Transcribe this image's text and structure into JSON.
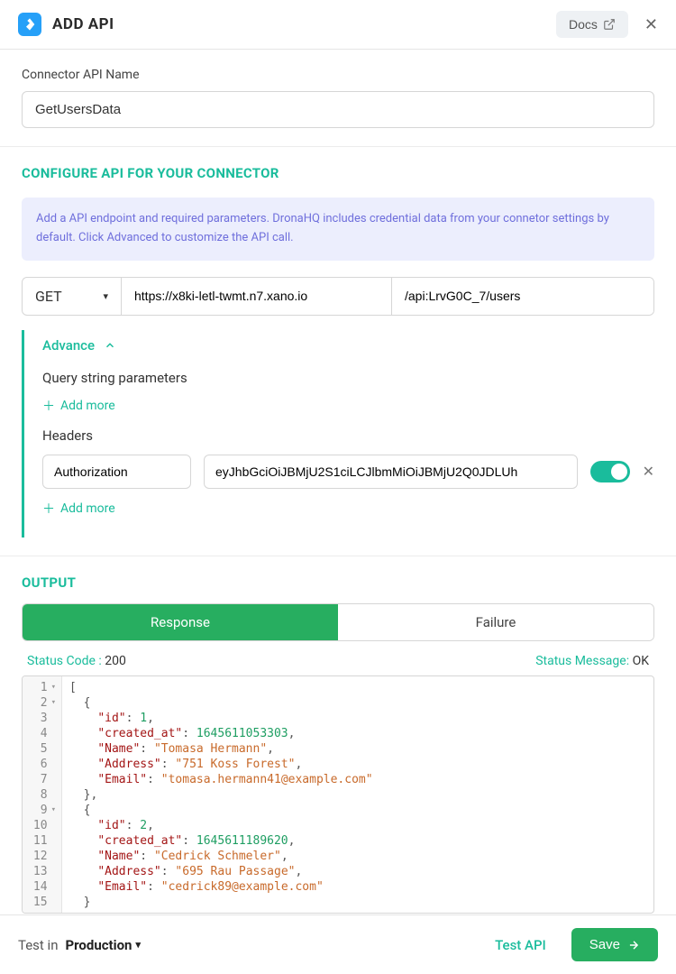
{
  "header": {
    "title": "ADD API",
    "docs_label": "Docs"
  },
  "connector": {
    "name_label": "Connector API Name",
    "name_value": "GetUsersData"
  },
  "configure": {
    "title": "CONFIGURE API FOR YOUR CONNECTOR",
    "info": "Add a API endpoint and required parameters. DronaHQ includes credential data from your connetor settings by default. Click Advanced to customize the API call.",
    "method": "GET",
    "url": "https://x8ki-letl-twmt.n7.xano.io",
    "path": "/api:LrvG0C_7/users",
    "advance_label": "Advance",
    "query_label": "Query string parameters",
    "add_more_label": "Add more",
    "headers_label": "Headers",
    "header_key": "Authorization",
    "header_value": "eyJhbGciOiJBMjU2S1ciLCJlbmMiOiJBMjU2Q0JDLUh"
  },
  "output": {
    "title": "OUTPUT",
    "tab_response": "Response",
    "tab_failure": "Failure",
    "status_code_label": "Status Code :",
    "status_code": "200",
    "status_msg_label": "Status Message:",
    "status_msg": "OK",
    "response_data": [
      {
        "id": 1,
        "created_at": 1645611053303,
        "Name": "Tomasa Hermann",
        "Address": "751 Koss Forest",
        "Email": "tomasa.hermann41@example.com"
      },
      {
        "id": 2,
        "created_at": 1645611189620,
        "Name": "Cedrick Schmeler",
        "Address": "695 Rau Passage",
        "Email": "cedrick89@example.com"
      }
    ]
  },
  "footer": {
    "testin_label": "Test in",
    "env": "Production",
    "test_api": "Test API",
    "save": "Save"
  },
  "colors": {
    "accent": "#1abc9c",
    "primary_button": "#27ae60",
    "info_bg": "#eceefd"
  }
}
